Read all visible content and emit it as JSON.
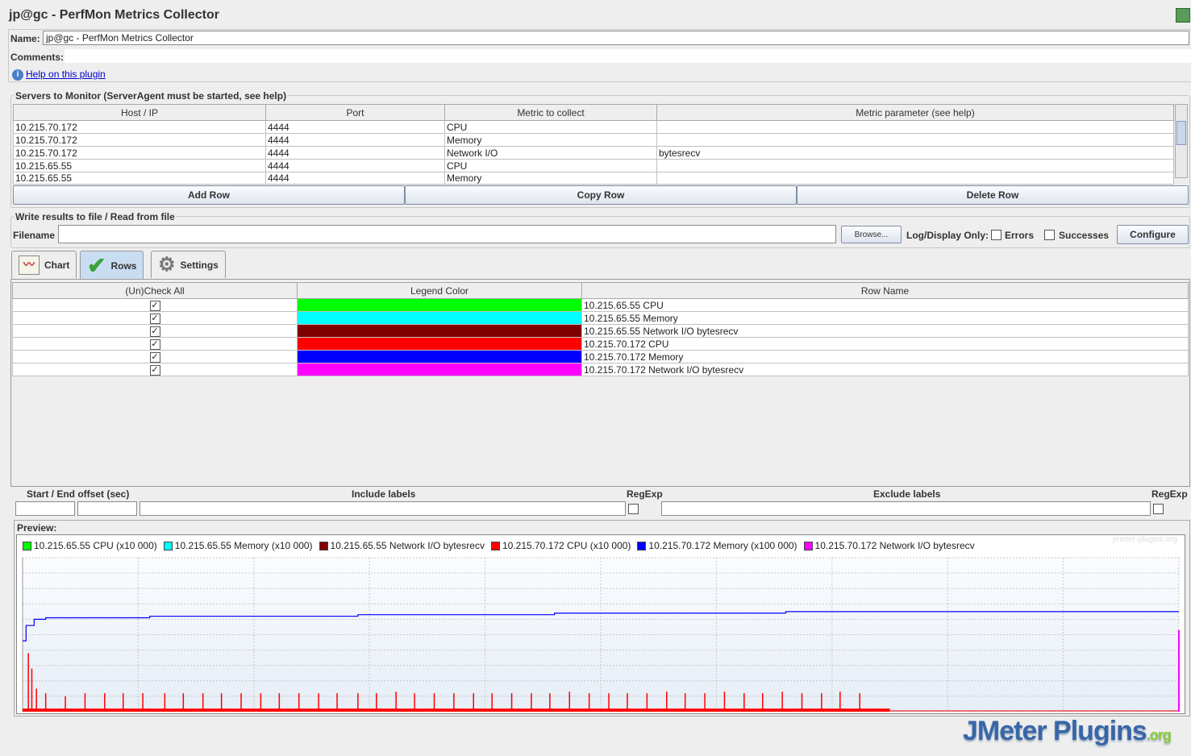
{
  "window": {
    "title": "jp@gc - PerfMon Metrics Collector"
  },
  "form": {
    "name_label": "Name:",
    "name_value": "jp@gc - PerfMon Metrics Collector",
    "comments_label": "Comments:",
    "comments_value": "",
    "help_link": "Help on this plugin"
  },
  "servers": {
    "title": "Servers to Monitor (ServerAgent must be started, see help)",
    "columns": [
      "Host / IP",
      "Port",
      "Metric to collect",
      "Metric parameter (see help)"
    ],
    "rows": [
      [
        "10.215.70.172",
        "4444",
        "CPU",
        ""
      ],
      [
        "10.215.70.172",
        "4444",
        "Memory",
        ""
      ],
      [
        "10.215.70.172",
        "4444",
        "Network I/O",
        "bytesrecv"
      ],
      [
        "10.215.65.55",
        "4444",
        "CPU",
        ""
      ],
      [
        "10.215.65.55",
        "4444",
        "Memory",
        ""
      ]
    ],
    "add_row": "Add Row",
    "copy_row": "Copy Row",
    "delete_row": "Delete Row"
  },
  "file": {
    "title": "Write results to file / Read from file",
    "filename_label": "Filename",
    "filename_value": "",
    "browse": "Browse...",
    "log_only": "Log/Display Only:",
    "errors": "Errors",
    "successes": "Successes",
    "configure": "Configure"
  },
  "tabs": [
    {
      "label": "Chart"
    },
    {
      "label": "Rows",
      "selected": true
    },
    {
      "label": "Settings"
    }
  ],
  "rows_table": {
    "columns": [
      "(Un)Check All",
      "Legend Color",
      "Row Name"
    ],
    "rows": [
      {
        "checked": true,
        "color": "#00ff00",
        "name": "10.215.65.55 CPU"
      },
      {
        "checked": true,
        "color": "#00ffff",
        "name": "10.215.65.55 Memory"
      },
      {
        "checked": true,
        "color": "#800000",
        "name": "10.215.65.55 Network I/O bytesrecv"
      },
      {
        "checked": true,
        "color": "#ff0000",
        "name": "10.215.70.172 CPU"
      },
      {
        "checked": true,
        "color": "#0000ff",
        "name": "10.215.70.172 Memory"
      },
      {
        "checked": true,
        "color": "#ff00ff",
        "name": "10.215.70.172 Network I/O bytesrecv"
      }
    ]
  },
  "filters": {
    "offset_label": "Start / End offset (sec)",
    "include_label": "Include labels",
    "regexp_label": "RegExp",
    "exclude_label": "Exclude labels"
  },
  "preview": {
    "label": "Preview:",
    "watermark": "jmeter-plugins.org",
    "logo": "JMeter Plugins.org"
  },
  "chart_data": {
    "type": "line",
    "title": "",
    "xlabel": "",
    "ylabel": "",
    "ylim": [
      0,
      1
    ],
    "xlim": [
      0,
      100
    ],
    "grid": true,
    "legend": "top",
    "legend_entries": [
      {
        "name": "10.215.65.55 CPU (x10 000)",
        "color": "#00ff00"
      },
      {
        "name": "10.215.65.55 Memory (x10 000)",
        "color": "#00ffff"
      },
      {
        "name": "10.215.65.55 Network I/O bytesrecv",
        "color": "#800000"
      },
      {
        "name": "10.215.70.172 CPU (x10 000)",
        "color": "#ff0000"
      },
      {
        "name": "10.215.70.172 Memory (x100 000)",
        "color": "#0000ff"
      },
      {
        "name": "10.215.70.172 Network I/O bytesrecv",
        "color": "#ff00ff"
      }
    ],
    "series": [
      {
        "name": "10.215.70.172 Memory (x100 000)",
        "color": "#0000ff",
        "x": [
          0,
          0.3,
          0.6,
          1,
          2,
          10,
          11,
          28,
          29,
          45,
          46,
          65,
          66,
          75,
          100
        ],
        "y": [
          0.46,
          0.56,
          0.56,
          0.6,
          0.61,
          0.61,
          0.62,
          0.62,
          0.63,
          0.63,
          0.64,
          0.64,
          0.65,
          0.65,
          0.65
        ]
      },
      {
        "name": "10.215.70.172 CPU (x10 000)",
        "color": "#ff0000",
        "baseline": 0.02,
        "end": 75,
        "spike_x": [
          0.5,
          0.8,
          1.2,
          2,
          3.7,
          5.4,
          7.1,
          8.7,
          10.4,
          12.3,
          13.9,
          15.6,
          17.2,
          18.9,
          20.6,
          22.2,
          23.9,
          25.6,
          27.2,
          29,
          30.6,
          32.3,
          33.9,
          35.6,
          37.3,
          39,
          40.6,
          42.3,
          44,
          45.6,
          47.3,
          49,
          50.7,
          52.3,
          54,
          55.7,
          57.3,
          59,
          60.7,
          62.4,
          64,
          65.7,
          67.4,
          69.1,
          70.7,
          72.4
        ],
        "spike_y": [
          0.38,
          0.28,
          0.15,
          0.12,
          0.1,
          0.12,
          0.12,
          0.12,
          0.12,
          0.12,
          0.12,
          0.12,
          0.12,
          0.12,
          0.12,
          0.12,
          0.12,
          0.12,
          0.12,
          0.12,
          0.12,
          0.13,
          0.12,
          0.12,
          0.12,
          0.12,
          0.12,
          0.12,
          0.12,
          0.12,
          0.13,
          0.12,
          0.12,
          0.12,
          0.12,
          0.13,
          0.12,
          0.12,
          0.13,
          0.12,
          0.12,
          0.13,
          0.12,
          0.12,
          0.13,
          0.12
        ]
      },
      {
        "name": "10.215.70.172 Network I/O bytesrecv",
        "color": "#ff00ff",
        "x": [
          99.8,
          100
        ],
        "y": [
          0,
          0.53
        ]
      }
    ]
  }
}
